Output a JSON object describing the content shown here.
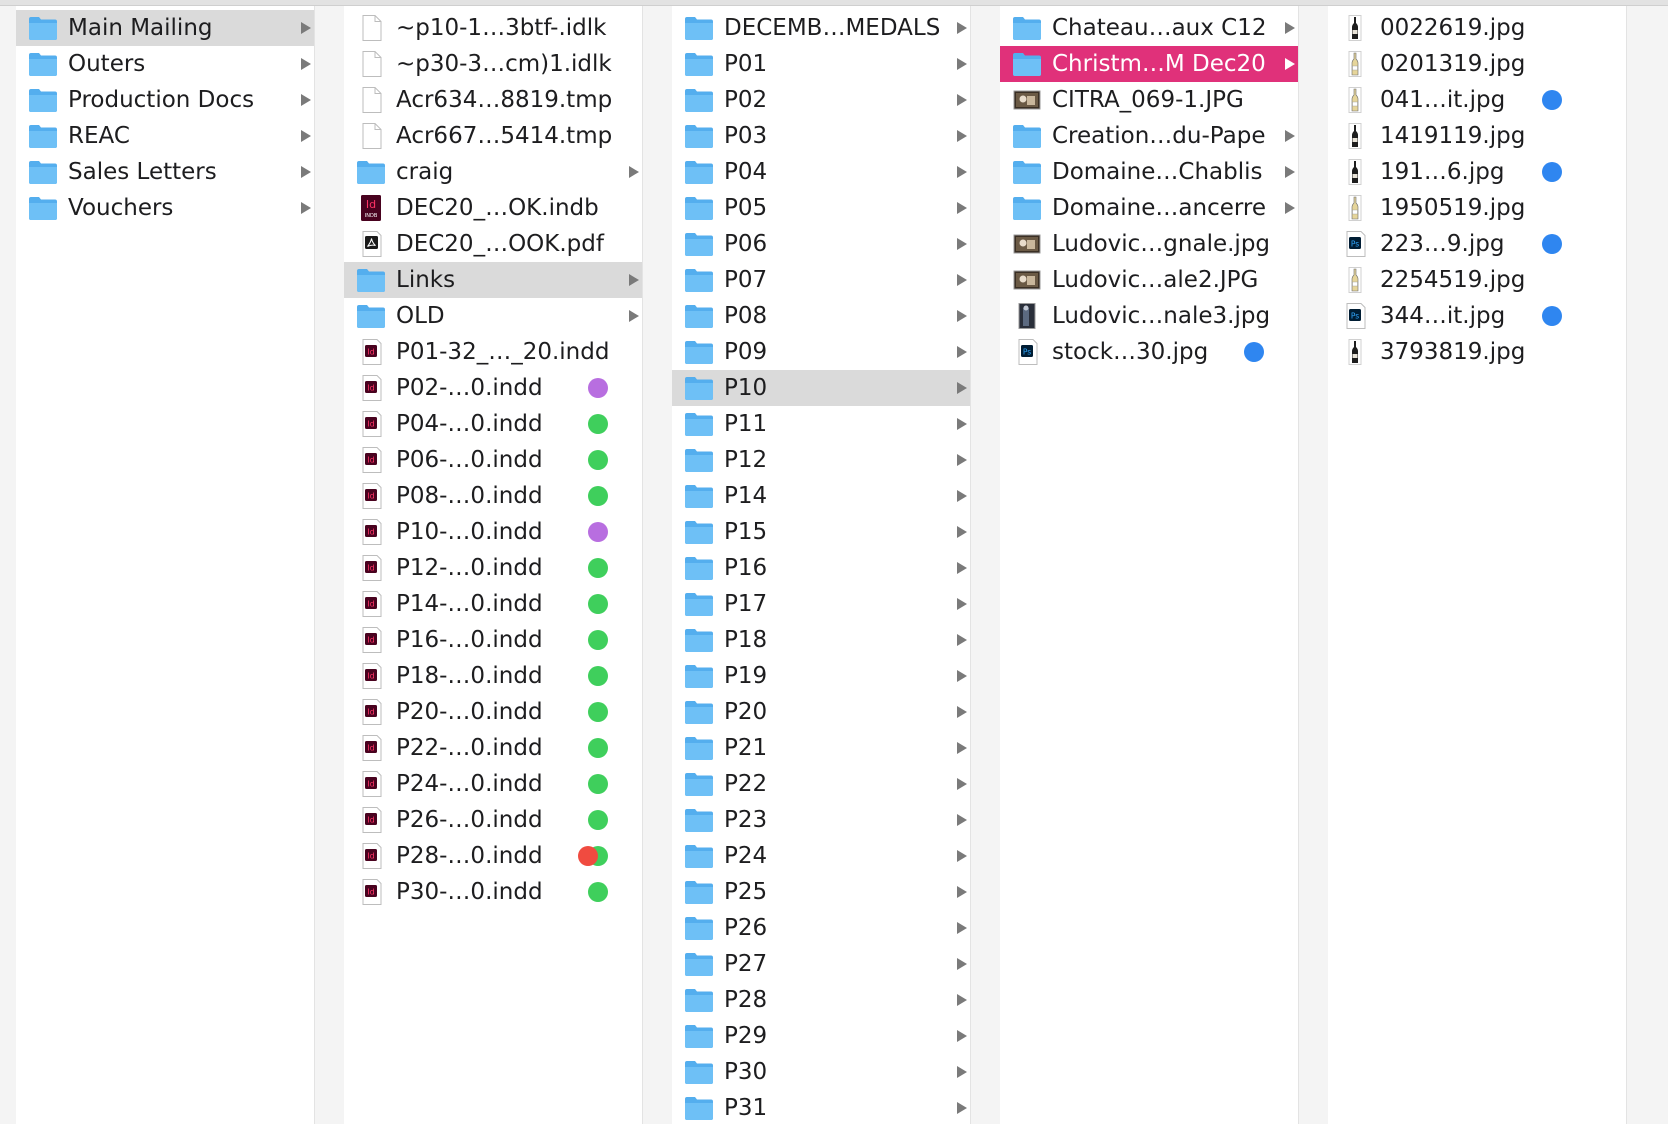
{
  "window": {
    "view": "column"
  },
  "colors": {
    "selection_active": "#e0317a",
    "selection_inactive": "#dadada",
    "folder": "#5fb6f3",
    "tag_green": "#3fcf5c",
    "tag_purple": "#b86ee0",
    "tag_blue": "#2f86f0",
    "tag_red": "#f04b40"
  },
  "columns": [
    {
      "items": [
        {
          "label": "Main Mailing",
          "icon": "folder-icon",
          "arrow": true,
          "selected": "inactive"
        },
        {
          "label": "Outers",
          "icon": "folder-icon",
          "arrow": true
        },
        {
          "label": "Production Docs",
          "icon": "folder-icon",
          "arrow": true
        },
        {
          "label": "REAC",
          "icon": "folder-icon",
          "arrow": true
        },
        {
          "label": "Sales Letters",
          "icon": "folder-icon",
          "arrow": true
        },
        {
          "label": "Vouchers",
          "icon": "folder-icon",
          "arrow": true
        }
      ]
    },
    {
      "items": [
        {
          "label": "~p10-1…3btf-.idlk",
          "icon": "document-icon"
        },
        {
          "label": "~p30-3…cm)1.idlk",
          "icon": "document-icon"
        },
        {
          "label": "Acr634…8819.tmp",
          "icon": "document-icon"
        },
        {
          "label": "Acr667…5414.tmp",
          "icon": "document-icon"
        },
        {
          "label": "craig",
          "icon": "folder-icon",
          "arrow": true
        },
        {
          "label": "DEC20_…OK.indb",
          "icon": "indesign-book-icon"
        },
        {
          "label": "DEC20_…OOK.pdf",
          "icon": "pdf-icon"
        },
        {
          "label": "Links",
          "icon": "folder-icon",
          "arrow": true,
          "selected": "inactive"
        },
        {
          "label": "OLD",
          "icon": "folder-icon",
          "arrow": true
        },
        {
          "label": "P01-32_…_20.indd",
          "icon": "indesign-icon"
        },
        {
          "label": "P02-…0.indd",
          "icon": "indesign-icon",
          "tags": [
            "purple"
          ]
        },
        {
          "label": "P04-…0.indd",
          "icon": "indesign-icon",
          "tags": [
            "green"
          ]
        },
        {
          "label": "P06-…0.indd",
          "icon": "indesign-icon",
          "tags": [
            "green"
          ]
        },
        {
          "label": "P08-…0.indd",
          "icon": "indesign-icon",
          "tags": [
            "green"
          ]
        },
        {
          "label": "P10-…0.indd",
          "icon": "indesign-icon",
          "tags": [
            "purple"
          ]
        },
        {
          "label": "P12-…0.indd",
          "icon": "indesign-icon",
          "tags": [
            "green"
          ]
        },
        {
          "label": "P14-…0.indd",
          "icon": "indesign-icon",
          "tags": [
            "green"
          ]
        },
        {
          "label": "P16-…0.indd",
          "icon": "indesign-icon",
          "tags": [
            "green"
          ]
        },
        {
          "label": "P18-…0.indd",
          "icon": "indesign-icon",
          "tags": [
            "green"
          ]
        },
        {
          "label": "P20-…0.indd",
          "icon": "indesign-icon",
          "tags": [
            "green"
          ]
        },
        {
          "label": "P22-…0.indd",
          "icon": "indesign-icon",
          "tags": [
            "green"
          ]
        },
        {
          "label": "P24-…0.indd",
          "icon": "indesign-icon",
          "tags": [
            "green"
          ]
        },
        {
          "label": "P26-…0.indd",
          "icon": "indesign-icon",
          "tags": [
            "green"
          ]
        },
        {
          "label": "P28-…0.indd",
          "icon": "indesign-icon",
          "tags": [
            "red",
            "green"
          ]
        },
        {
          "label": "P30-…0.indd",
          "icon": "indesign-icon",
          "tags": [
            "green"
          ]
        }
      ]
    },
    {
      "items": [
        {
          "label": "DECEMB…MEDALS",
          "icon": "folder-icon",
          "arrow": true
        },
        {
          "label": "P01",
          "icon": "folder-icon",
          "arrow": true
        },
        {
          "label": "P02",
          "icon": "folder-icon",
          "arrow": true
        },
        {
          "label": "P03",
          "icon": "folder-icon",
          "arrow": true
        },
        {
          "label": "P04",
          "icon": "folder-icon",
          "arrow": true
        },
        {
          "label": "P05",
          "icon": "folder-icon",
          "arrow": true
        },
        {
          "label": "P06",
          "icon": "folder-icon",
          "arrow": true
        },
        {
          "label": "P07",
          "icon": "folder-icon",
          "arrow": true
        },
        {
          "label": "P08",
          "icon": "folder-icon",
          "arrow": true
        },
        {
          "label": "P09",
          "icon": "folder-icon",
          "arrow": true
        },
        {
          "label": "P10",
          "icon": "folder-icon",
          "arrow": true,
          "selected": "inactive"
        },
        {
          "label": "P11",
          "icon": "folder-icon",
          "arrow": true
        },
        {
          "label": "P12",
          "icon": "folder-icon",
          "arrow": true
        },
        {
          "label": "P14",
          "icon": "folder-icon",
          "arrow": true
        },
        {
          "label": "P15",
          "icon": "folder-icon",
          "arrow": true
        },
        {
          "label": "P16",
          "icon": "folder-icon",
          "arrow": true
        },
        {
          "label": "P17",
          "icon": "folder-icon",
          "arrow": true
        },
        {
          "label": "P18",
          "icon": "folder-icon",
          "arrow": true
        },
        {
          "label": "P19",
          "icon": "folder-icon",
          "arrow": true
        },
        {
          "label": "P20",
          "icon": "folder-icon",
          "arrow": true
        },
        {
          "label": "P21",
          "icon": "folder-icon",
          "arrow": true
        },
        {
          "label": "P22",
          "icon": "folder-icon",
          "arrow": true
        },
        {
          "label": "P23",
          "icon": "folder-icon",
          "arrow": true
        },
        {
          "label": "P24",
          "icon": "folder-icon",
          "arrow": true
        },
        {
          "label": "P25",
          "icon": "folder-icon",
          "arrow": true
        },
        {
          "label": "P26",
          "icon": "folder-icon",
          "arrow": true
        },
        {
          "label": "P27",
          "icon": "folder-icon",
          "arrow": true
        },
        {
          "label": "P28",
          "icon": "folder-icon",
          "arrow": true
        },
        {
          "label": "P29",
          "icon": "folder-icon",
          "arrow": true
        },
        {
          "label": "P30",
          "icon": "folder-icon",
          "arrow": true
        },
        {
          "label": "P31",
          "icon": "folder-icon",
          "arrow": true
        }
      ]
    },
    {
      "items": [
        {
          "label": "Chateau…aux C12",
          "icon": "folder-icon",
          "arrow": true
        },
        {
          "label": "Christm…M Dec20",
          "icon": "folder-icon",
          "arrow": true,
          "selected": "active"
        },
        {
          "label": "CITRA_069-1.JPG",
          "icon": "photo-thumbnail-icon"
        },
        {
          "label": "Creation…du-Pape",
          "icon": "folder-icon",
          "arrow": true
        },
        {
          "label": "Domaine…Chablis",
          "icon": "folder-icon",
          "arrow": true
        },
        {
          "label": "Domaine…ancerre",
          "icon": "folder-icon",
          "arrow": true
        },
        {
          "label": "Ludovic…gnale.jpg",
          "icon": "photo-thumbnail-icon"
        },
        {
          "label": "Ludovic…ale2.JPG",
          "icon": "photo-thumbnail-icon"
        },
        {
          "label": "Ludovic…nale3.jpg",
          "icon": "photo-portrait-icon"
        },
        {
          "label": "stock…30.jpg",
          "icon": "photoshop-icon",
          "tags": [
            "blue"
          ]
        }
      ]
    },
    {
      "items": [
        {
          "label": "0022619.jpg",
          "icon": "bottle-dark-icon"
        },
        {
          "label": "0201319.jpg",
          "icon": "bottle-light-icon"
        },
        {
          "label": "041…it.jpg",
          "icon": "bottle-light-icon",
          "tags": [
            "blue"
          ]
        },
        {
          "label": "1419119.jpg",
          "icon": "bottle-dark-icon"
        },
        {
          "label": "191…6.jpg",
          "icon": "bottle-dark-icon",
          "tags": [
            "blue"
          ]
        },
        {
          "label": "1950519.jpg",
          "icon": "bottle-light-icon"
        },
        {
          "label": "223…9.jpg",
          "icon": "photoshop-icon",
          "tags": [
            "blue"
          ]
        },
        {
          "label": "2254519.jpg",
          "icon": "bottle-light-icon"
        },
        {
          "label": "344…it.jpg",
          "icon": "photoshop-icon",
          "tags": [
            "blue"
          ]
        },
        {
          "label": "3793819.jpg",
          "icon": "bottle-dark-icon"
        }
      ]
    }
  ]
}
